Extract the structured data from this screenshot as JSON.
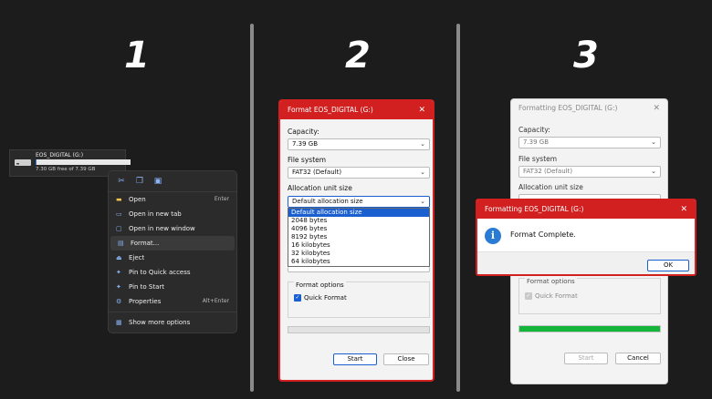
{
  "steps": [
    "1",
    "2",
    "3"
  ],
  "drive": {
    "name": "EOS_DIGITAL (G:)",
    "free": "7.30 GB free of 7.39 GB",
    "used_fraction": 0.012
  },
  "context_menu": {
    "top_icons": [
      "cut-icon",
      "copy-icon",
      "rename-icon"
    ],
    "items": [
      {
        "label": "Open",
        "shortcut": "Enter",
        "icon": "folder-icon"
      },
      {
        "label": "Open in new tab",
        "shortcut": "",
        "icon": "tab-icon"
      },
      {
        "label": "Open in new window",
        "shortcut": "",
        "icon": "window-icon"
      },
      {
        "label": "Format...",
        "shortcut": "",
        "icon": "format-icon"
      },
      {
        "label": "Eject",
        "shortcut": "",
        "icon": "eject-icon"
      },
      {
        "label": "Pin to Quick access",
        "shortcut": "",
        "icon": "pin-icon"
      },
      {
        "label": "Pin to Start",
        "shortcut": "",
        "icon": "pin-icon"
      },
      {
        "label": "Properties",
        "shortcut": "Alt+Enter",
        "icon": "wrench-icon"
      },
      {
        "label": "Show more options",
        "shortcut": "",
        "icon": "more-icon"
      }
    ]
  },
  "format_dialog": {
    "title": "Format EOS_DIGITAL (G:)",
    "capacity_label": "Capacity:",
    "capacity_value": "7.39 GB",
    "fs_label": "File system",
    "fs_value": "FAT32 (Default)",
    "alloc_label": "Allocation unit size",
    "alloc_value": "Default allocation size",
    "alloc_options": [
      "Default allocation size",
      "2048 bytes",
      "4096 bytes",
      "8192 bytes",
      "16 kilobytes",
      "32 kilobytes",
      "64 kilobytes"
    ],
    "format_options_label": "Format options",
    "quick_format_label": "Quick Format",
    "start_label": "Start",
    "close_label": "Close"
  },
  "formatting_dialog": {
    "title": "Formatting EOS_DIGITAL (G:)",
    "capacity_label": "Capacity:",
    "capacity_value": "7.39 GB",
    "fs_label": "File system",
    "fs_value": "FAT32 (Default)",
    "alloc_label": "Allocation unit size",
    "format_options_label": "Format options",
    "quick_format_label": "Quick Format",
    "start_label": "Start",
    "cancel_label": "Cancel",
    "progress": 1.0
  },
  "complete_popup": {
    "title": "Formatting EOS_DIGITAL (G:)",
    "message": "Format Complete.",
    "ok_label": "OK"
  },
  "colors": {
    "accent_red": "#d21f1f",
    "progress_green": "#13b53a",
    "select_blue": "#1a5fd0"
  }
}
